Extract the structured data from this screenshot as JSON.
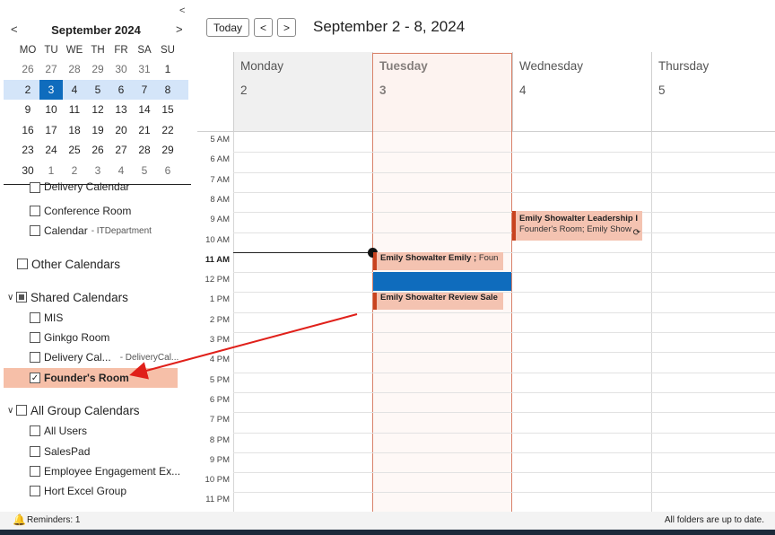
{
  "mini_calendar": {
    "title": "September 2024",
    "prev_icon": "<",
    "next_icon": ">",
    "collapse_icon": "<",
    "dow": [
      "MO",
      "TU",
      "WE",
      "TH",
      "FR",
      "SA",
      "SU"
    ],
    "weeks": [
      [
        "26",
        "27",
        "28",
        "29",
        "30",
        "31",
        "1"
      ],
      [
        "2",
        "3",
        "4",
        "5",
        "6",
        "7",
        "8"
      ],
      [
        "9",
        "10",
        "11",
        "12",
        "13",
        "14",
        "15"
      ],
      [
        "16",
        "17",
        "18",
        "19",
        "20",
        "21",
        "22"
      ],
      [
        "23",
        "24",
        "25",
        "26",
        "27",
        "28",
        "29"
      ],
      [
        "30",
        "1",
        "2",
        "3",
        "4",
        "5",
        "6"
      ]
    ]
  },
  "folders": {
    "delivery_calendar_partial": "Delivery Calendar",
    "conference_room": "Conference Room",
    "calendar": "Calendar",
    "calendar_sub": "- ITDepartment",
    "other_calendars": "Other Calendars",
    "shared_calendars": "Shared Calendars",
    "mis": "MIS",
    "ginkgo_room": "Ginkgo Room",
    "delivery_cal": "Delivery Cal...",
    "delivery_cal_sub": "- DeliveryCal...",
    "founders_room": "Founder's Room",
    "all_group_calendars": "All Group Calendars",
    "all_users": "All Users",
    "salespad": "SalesPad",
    "employee_engagement": "Employee Engagement Ex...",
    "hort_excel_group": "Hort Excel Group"
  },
  "toolbar": {
    "today_label": "Today",
    "prev_icon": "<",
    "next_icon": ">",
    "range": "September 2 - 8, 2024"
  },
  "days": [
    {
      "name": "Monday",
      "num": "2"
    },
    {
      "name": "Tuesday",
      "num": "3"
    },
    {
      "name": "Wednesday",
      "num": "4"
    },
    {
      "name": "Thursday",
      "num": "5"
    }
  ],
  "hours": [
    "5 AM",
    "6 AM",
    "7 AM",
    "8 AM",
    "9 AM",
    "10 AM",
    "11 AM",
    "12 PM",
    "1 PM",
    "2 PM",
    "3 PM",
    "4 PM",
    "5 PM",
    "6 PM",
    "7 PM",
    "8 PM",
    "9 PM",
    "10 PM",
    "11 PM"
  ],
  "events": {
    "wed_leadership_title": "Emily Showalter Leadership I",
    "wed_leadership_loc": "Founder's Room; Emily Show",
    "tue_11_title": "Emily Showalter Emily ;",
    "tue_11_loc": "Foun",
    "tue_1_title": "Emily Showalter Review Sale"
  },
  "status": {
    "reminders": "Reminders: 1",
    "sync": "All folders are up to date."
  },
  "colors": {
    "accent": "#0f6cbd",
    "event_bg": "#f4c3b1",
    "event_border": "#c8431f",
    "annotation_arrow": "#e0201a",
    "selected_folder": "#f6bfa8"
  }
}
